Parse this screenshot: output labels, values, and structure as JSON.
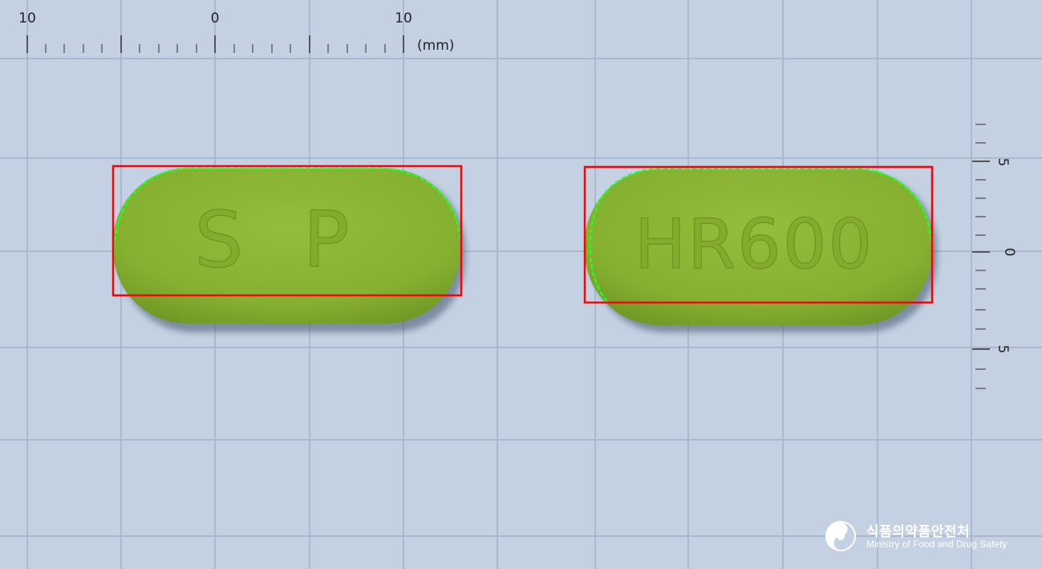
{
  "ruler_top": {
    "labels": [
      "10",
      "0",
      "10"
    ],
    "unit": "(mm)"
  },
  "ruler_right": {
    "labels": [
      "5",
      "0",
      "5"
    ]
  },
  "pills": [
    {
      "imprint": "S P",
      "color": "#8bb534"
    },
    {
      "imprint": "HR600",
      "color": "#8bb534"
    }
  ],
  "colors": {
    "background": "#c3d1e3",
    "grid": "#a6b8cf",
    "bounding_box": "#ff0000",
    "contour": "#22ff22"
  },
  "logo": {
    "korean": "식품의약품안전처",
    "english": "Ministry of Food and Drug Safety",
    "icon": "mfds-emblem-icon"
  }
}
